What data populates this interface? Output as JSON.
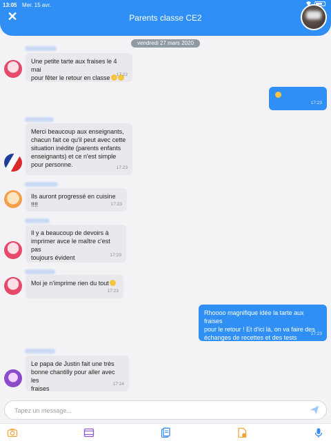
{
  "status": {
    "time": "13:05",
    "date": "Mer. 15 avr."
  },
  "header": {
    "title": "Parents classe CE2",
    "close_symbol": "✕"
  },
  "date_separator": "vendredi 27 mars 2020",
  "messages": [
    {
      "text": "Une petite tarte aux fraises le 4 mai\npour fêter le retour en classe",
      "time": "17:22"
    },
    {
      "text": "",
      "time": "17:23"
    },
    {
      "text": "Merci beaucoup aux enseignants,\nchacun fait ce qu'il peut avec cette\nsituation inédite (parents enfants\nenseignants) et ce n'est simple\npour personne.",
      "time": "17:23"
    },
    {
      "text": "Ils auront progressé en cuisine !!!!",
      "time": "17:23"
    },
    {
      "text": "Il y a beaucoup de devoirs à\nimprimer avce le maître c'est pas\ntoujours évident",
      "time": "17:23"
    },
    {
      "text": "Moi je n'imprime rien du tout",
      "time": "17:23"
    },
    {
      "text": "Rhoooo magnifique idée la tarte aux fraises\npour le retour !  Et d'ici là, on va faire des\néchanges de recettes et des tests",
      "time": "17:23"
    },
    {
      "text": "Le papa de Justin fait une très\nbonne chantilly pour aller avec les\nfraises",
      "time": "17:24"
    }
  ],
  "input": {
    "placeholder": "Tapez un message..."
  },
  "colors": {
    "accent": "#2f8ff5",
    "incoming_bubble": "#e8e8ed",
    "background": "#f3f3f6"
  },
  "icons": [
    "close-icon",
    "camera-icon",
    "video-icon",
    "documents-icon",
    "file-icon",
    "microphone-icon",
    "send-icon"
  ]
}
